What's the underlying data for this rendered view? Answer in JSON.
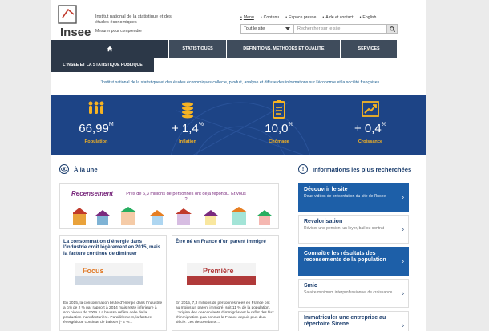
{
  "header": {
    "logo_text": "Insee",
    "tagline": "Institut national de la statistique et des études économiques",
    "subtagline": "Mesurer pour comprendre",
    "top_links": [
      "Menu",
      "Contenu",
      "Espace presse",
      "Aide et contact",
      "English"
    ],
    "search_scope": "Tout le site",
    "search_placeholder": "Rechercher sur le site"
  },
  "nav": {
    "items": [
      "STATISTIQUES",
      "DÉFINITIONS, MÉTHODES ET QUALITÉ",
      "SERVICES"
    ],
    "sub_item": "L'INSEE ET LA STATISTIQUE PUBLIQUE"
  },
  "intro": "L'Institut national de la statistique et des études économiques collecte, produit, analyse et diffuse des informations sur l'économie et la société françaises",
  "stats": [
    {
      "value": "66,99",
      "sup": "M",
      "label": "Population",
      "icon": "people-icon"
    },
    {
      "value": "+ 1,4",
      "sup": "%",
      "label": "Inflation",
      "icon": "coins-icon"
    },
    {
      "value": "10,0",
      "sup": "%",
      "label": "Chômage",
      "icon": "clipboard-icon"
    },
    {
      "value": "+ 0,4",
      "sup": "%",
      "label": "Croissance",
      "icon": "chart-up-icon"
    }
  ],
  "la_une": {
    "heading": "À la une",
    "banner_logo": "Recensement",
    "banner_text": "Près de 6,3 millions de personnes ont déjà répondu. Et vous ?",
    "cards": [
      {
        "title": "La consommation d'énergie dans l'industrie croît légèrement en 2015, mais la facture continue de diminuer",
        "pub_name": "Focus",
        "text": "En 2015, la consommation brute d'énergie dans l'industrie a crû de 2 % par rapport à 2014 mais reste inférieure à son niveau de 2009. La hausse reflète celle de la production manufacturière. Parallèlement, la facture énergétique continue de baisser (- 4 %..."
      },
      {
        "title": "Être né en France d'un parent immigré",
        "pub_name": "Première",
        "text": "En 2015, 7,3 millions de personnes nées en France ont au moins un parent immigré, soit 11 % de la population. L'origine des descendants d'immigrés est le reflet des flux d'immigration qu'a connus la France depuis plus d'un siècle. Les descendants..."
      }
    ]
  },
  "most_searched": {
    "heading": "Informations les plus recherchées",
    "items": [
      {
        "title": "Découvrir le site",
        "sub": "Deux vidéos de présentation du site de l'Insee",
        "style": "blue"
      },
      {
        "title": "Revalorisation",
        "sub": "Réviser une pension, un loyer, bail ou contrat",
        "style": "white"
      },
      {
        "title": "Connaître les résultats des recensements de la population",
        "sub": "",
        "style": "blue"
      },
      {
        "title": "Smic",
        "sub": "Salaire minimum interprofessionnel de croissance",
        "style": "white"
      },
      {
        "title": "Immatriculer une entreprise au répertoire Sirene",
        "sub": "",
        "style": "white"
      }
    ]
  },
  "colors": {
    "band": "#1d4486",
    "accent": "#f6b322",
    "nav": "#3f4c5c",
    "link": "#1d3f6e"
  }
}
